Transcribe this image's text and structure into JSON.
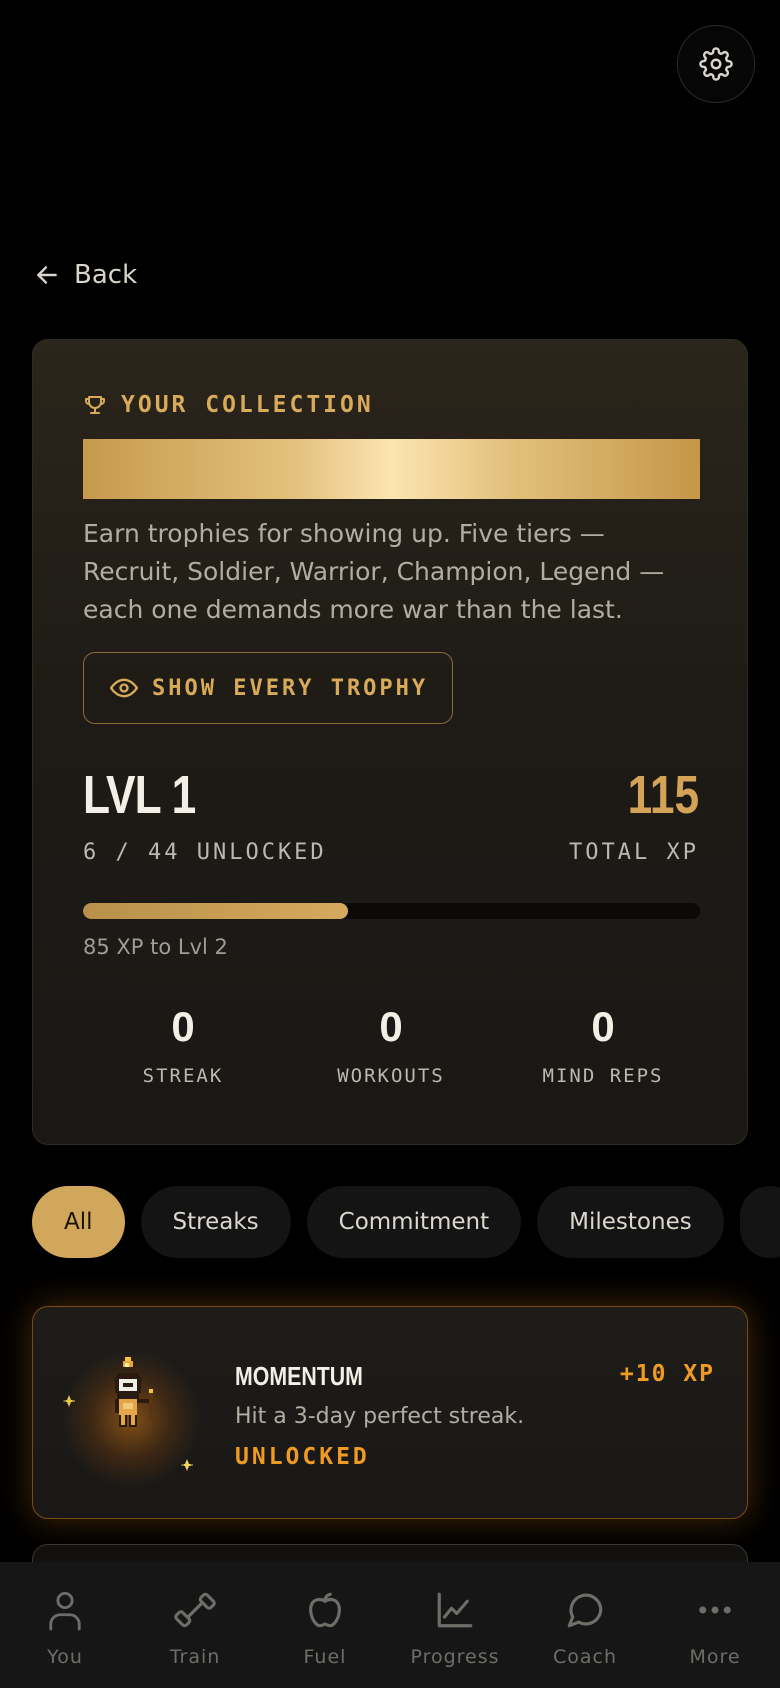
{
  "header": {
    "settings_icon": "gear-icon",
    "back_label": "Back",
    "back_icon": "arrow-left-icon"
  },
  "collection": {
    "icon": "trophy-icon",
    "title": "YOUR COLLECTION",
    "description": "Earn trophies for showing up. Five tiers — Recruit, Soldier, Warrior, Champion, Legend — each one demands more war than the last.",
    "show_button": {
      "icon": "eye-icon",
      "label": "SHOW EVERY TROPHY"
    },
    "level": "LVL 1",
    "unlocked": "6 / 44 UNLOCKED",
    "total_xp": "115",
    "total_xp_label": "TOTAL XP",
    "progress_fraction": 0.43,
    "progress_caption": "85 XP to Lvl 2",
    "stats": [
      {
        "value": "0",
        "label": "STREAK"
      },
      {
        "value": "0",
        "label": "WORKOUTS"
      },
      {
        "value": "0",
        "label": "MIND REPS"
      }
    ]
  },
  "filters": {
    "active": "All",
    "chips": [
      "All",
      "Streaks",
      "Commitment",
      "Milestones"
    ]
  },
  "achievements": [
    {
      "badge": "torch-warrior-badge",
      "title": "MOMENTUM",
      "description": "Hit a 3-day perfect streak.",
      "status": "UNLOCKED",
      "xp": "+10 XP"
    }
  ],
  "nav": {
    "items": [
      {
        "label": "You",
        "icon": "person-icon"
      },
      {
        "label": "Train",
        "icon": "dumbbell-icon"
      },
      {
        "label": "Fuel",
        "icon": "apple-icon"
      },
      {
        "label": "Progress",
        "icon": "chart-icon"
      },
      {
        "label": "Coach",
        "icon": "chat-bubble-icon"
      },
      {
        "label": "More",
        "icon": "more-dots-icon"
      }
    ]
  },
  "colors": {
    "accent_gold": "#d8aa5a",
    "unlocked_orange": "#ef9b22",
    "background": "#000000"
  }
}
